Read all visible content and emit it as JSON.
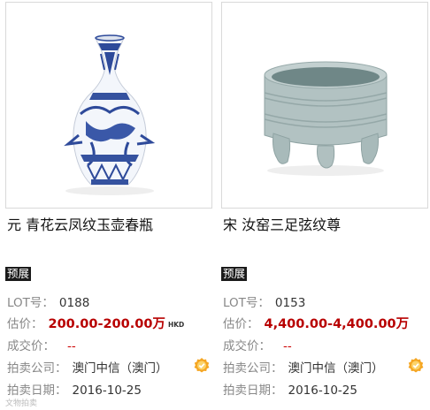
{
  "lots": [
    {
      "title": "元 青花云凤纹玉壶春瓶",
      "badge": "预展",
      "lot_label": "LOT号：",
      "lot_no": "0188",
      "estimate_label": "估价：",
      "estimate": "200.00-200.00万",
      "currency": "HKD",
      "deal_label": "成交价：",
      "deal": "--",
      "company_label": "拍卖公司：",
      "company": "澳门中信（澳门）",
      "date_label": "拍卖日期：",
      "date": "2016-10-25",
      "image_icon": "blue-white-porcelain-vase-image",
      "verified_icon": "verified-badge-icon"
    },
    {
      "title": "宋 汝窑三足弦纹尊",
      "badge": "预展",
      "lot_label": "LOT号：",
      "lot_no": "0153",
      "estimate_label": "估价：",
      "estimate": "4,400.00-4,400.00万",
      "currency": "",
      "deal_label": "成交价：",
      "deal": "--",
      "company_label": "拍卖公司：",
      "company": "澳门中信（澳门）",
      "date_label": "拍卖日期：",
      "date": "2016-10-25",
      "image_icon": "celadon-tripod-censer-image",
      "verified_icon": "verified-badge-icon"
    }
  ],
  "watermark": "文物拍卖",
  "colors": {
    "price": "#b80000",
    "badge_bg": "#1a1a1a",
    "verified": "#f5a623"
  }
}
